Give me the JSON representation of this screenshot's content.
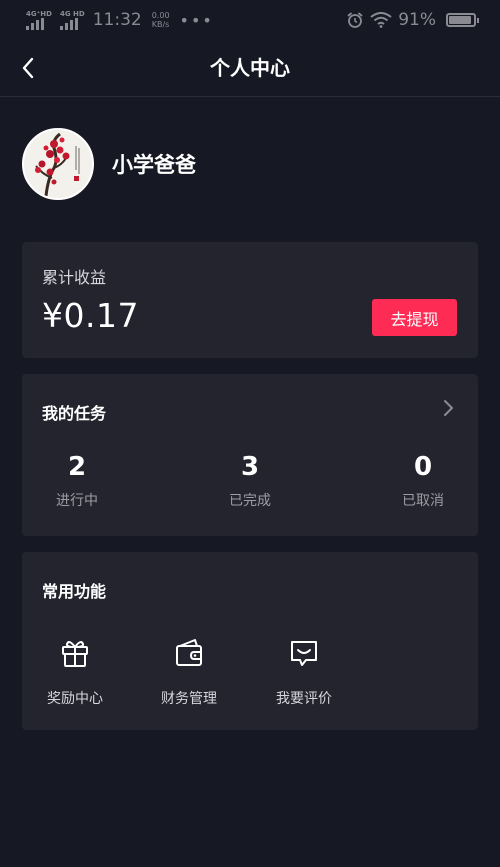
{
  "status_bar": {
    "network1": "4G⁺HD",
    "network2": "4G HD",
    "time": "11:32",
    "speed_value": "0.00",
    "speed_unit": "KB/s",
    "battery": "91%"
  },
  "nav": {
    "title": "个人中心"
  },
  "profile": {
    "username": "小学爸爸"
  },
  "earnings": {
    "label": "累计收益",
    "amount": "¥0.17",
    "withdraw_label": "去提现"
  },
  "tasks": {
    "title": "我的任务",
    "stats": [
      {
        "value": "2",
        "label": "进行中"
      },
      {
        "value": "3",
        "label": "已完成"
      },
      {
        "value": "0",
        "label": "已取消"
      }
    ]
  },
  "features": {
    "title": "常用功能",
    "items": [
      {
        "label": "奖励中心",
        "icon": "gift-icon"
      },
      {
        "label": "财务管理",
        "icon": "wallet-icon"
      },
      {
        "label": "我要评价",
        "icon": "comment-icon"
      }
    ]
  },
  "colors": {
    "background": "#161823",
    "card": "#23242e",
    "accent": "#fe2c55"
  }
}
